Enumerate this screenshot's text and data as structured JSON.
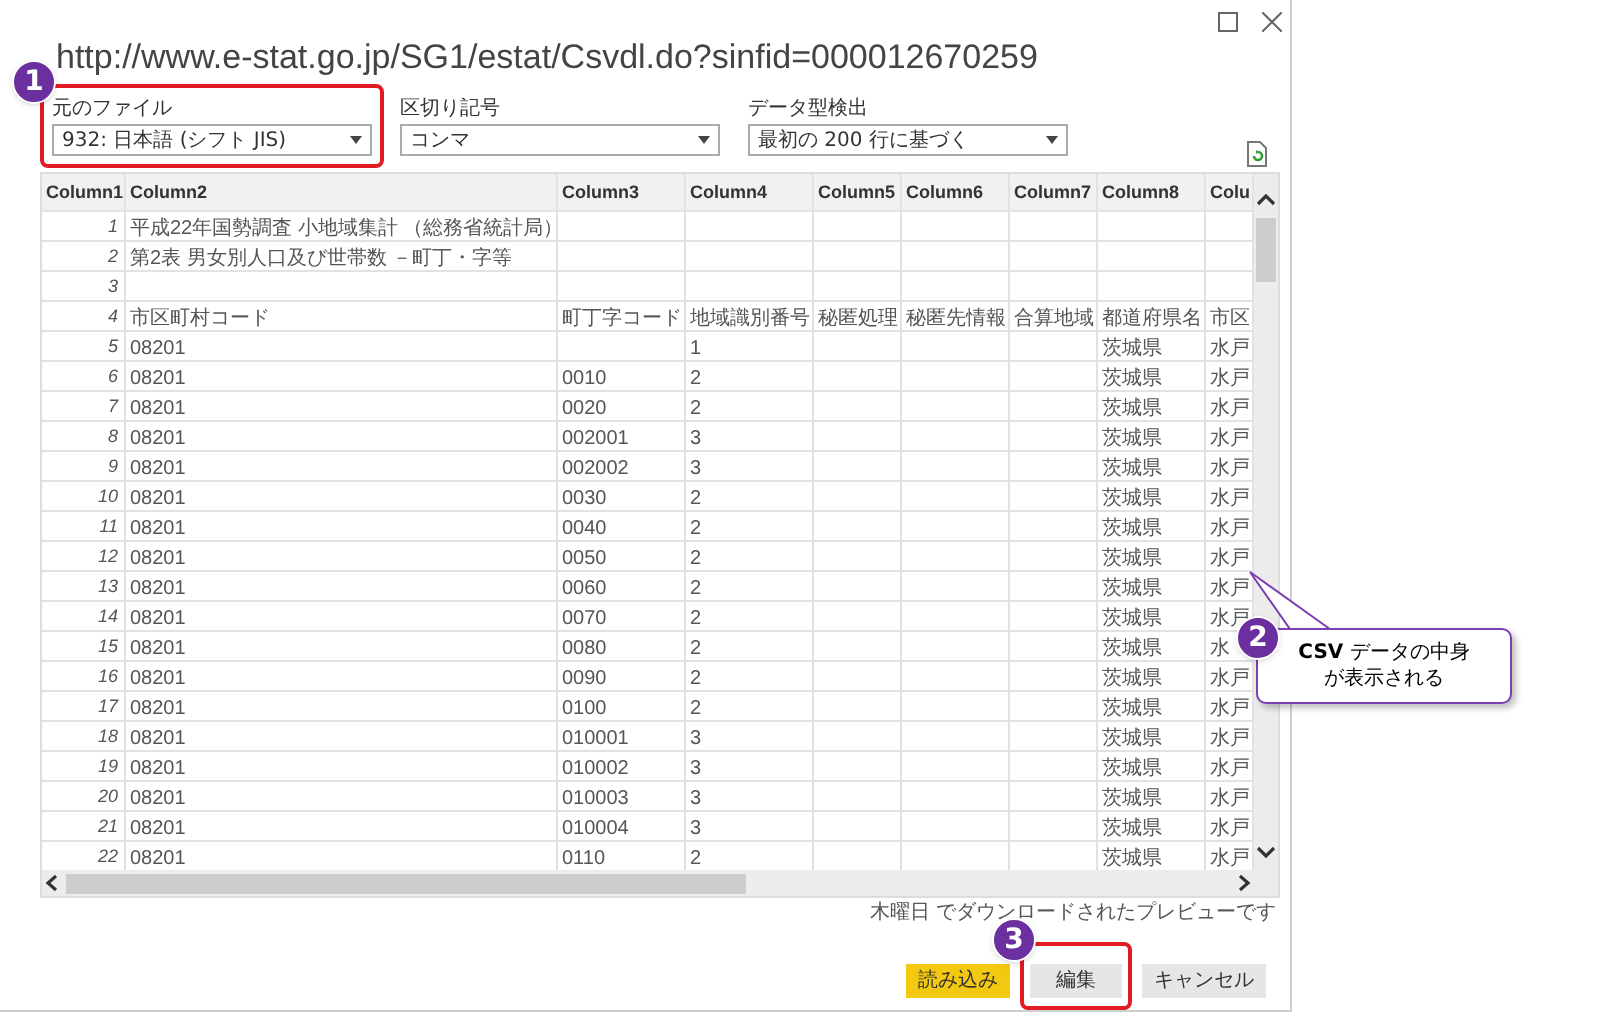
{
  "window": {
    "title": "http://www.e-stat.go.jp/SG1/estat/Csvdl.do?sinfid=000012670259"
  },
  "options": [
    {
      "label": "元のファイル",
      "value": "932: 日本語 (シフト JIS)",
      "highlighted": true
    },
    {
      "label": "区切り記号",
      "value": "コンマ",
      "highlighted": false
    },
    {
      "label": "データ型検出",
      "value": "最初の 200 行に基づく",
      "highlighted": false
    }
  ],
  "table": {
    "columns": [
      "Column1",
      "Column2",
      "Column3",
      "Column4",
      "Column5",
      "Column6",
      "Column7",
      "Column8",
      "Colu"
    ],
    "rows": [
      {
        "number": "1",
        "cells": {
          "column2": "平成22年国勢調査 小地域集計 （総務省統計局）"
        }
      },
      {
        "number": "2",
        "cells": {
          "column2": "第2表 男女別人口及び世帯数 －町丁・字等"
        }
      },
      {
        "number": "3",
        "cells": {}
      },
      {
        "number": "4",
        "cells": {
          "column2": "市区町村コード",
          "column3": "町丁字コード",
          "column4": "地域識別番号",
          "column5": "秘匿処理",
          "column6": "秘匿先情報",
          "column7": "合算地域",
          "column8": "都道府県名",
          "column9": "市区"
        }
      },
      {
        "number": "5",
        "cells": {
          "column2": "08201",
          "column4": "1",
          "column8": "茨城県",
          "column9": "水戸"
        }
      },
      {
        "number": "6",
        "cells": {
          "column2": "08201",
          "column3": "0010",
          "column4": "2",
          "column8": "茨城県",
          "column9": "水戸"
        }
      },
      {
        "number": "7",
        "cells": {
          "column2": "08201",
          "column3": "0020",
          "column4": "2",
          "column8": "茨城県",
          "column9": "水戸"
        }
      },
      {
        "number": "8",
        "cells": {
          "column2": "08201",
          "column3": "002001",
          "column4": "3",
          "column8": "茨城県",
          "column9": "水戸"
        }
      },
      {
        "number": "9",
        "cells": {
          "column2": "08201",
          "column3": "002002",
          "column4": "3",
          "column8": "茨城県",
          "column9": "水戸"
        }
      },
      {
        "number": "10",
        "cells": {
          "column2": "08201",
          "column3": "0030",
          "column4": "2",
          "column8": "茨城県",
          "column9": "水戸"
        }
      },
      {
        "number": "11",
        "cells": {
          "column2": "08201",
          "column3": "0040",
          "column4": "2",
          "column8": "茨城県",
          "column9": "水戸"
        }
      },
      {
        "number": "12",
        "cells": {
          "column2": "08201",
          "column3": "0050",
          "column4": "2",
          "column8": "茨城県",
          "column9": "水戸"
        }
      },
      {
        "number": "13",
        "cells": {
          "column2": "08201",
          "column3": "0060",
          "column4": "2",
          "column8": "茨城県",
          "column9": "水戸"
        }
      },
      {
        "number": "14",
        "cells": {
          "column2": "08201",
          "column3": "0070",
          "column4": "2",
          "column8": "茨城県",
          "column9": "水戸"
        }
      },
      {
        "number": "15",
        "cells": {
          "column2": "08201",
          "column3": "0080",
          "column4": "2",
          "column8": "茨城県",
          "column9": "水"
        }
      },
      {
        "number": "16",
        "cells": {
          "column2": "08201",
          "column3": "0090",
          "column4": "2",
          "column8": "茨城県",
          "column9": "水戸"
        }
      },
      {
        "number": "17",
        "cells": {
          "column2": "08201",
          "column3": "0100",
          "column4": "2",
          "column8": "茨城県",
          "column9": "水戸"
        }
      },
      {
        "number": "18",
        "cells": {
          "column2": "08201",
          "column3": "010001",
          "column4": "3",
          "column8": "茨城県",
          "column9": "水戸"
        }
      },
      {
        "number": "19",
        "cells": {
          "column2": "08201",
          "column3": "010002",
          "column4": "3",
          "column8": "茨城県",
          "column9": "水戸"
        }
      },
      {
        "number": "20",
        "cells": {
          "column2": "08201",
          "column3": "010003",
          "column4": "3",
          "column8": "茨城県",
          "column9": "水戸"
        }
      },
      {
        "number": "21",
        "cells": {
          "column2": "08201",
          "column3": "010004",
          "column4": "3",
          "column8": "茨城県",
          "column9": "水戸"
        }
      },
      {
        "number": "22",
        "cells": {
          "column2": "08201",
          "column3": "0110",
          "column4": "2",
          "column8": "茨城県",
          "column9": "水戸"
        }
      }
    ]
  },
  "status": "木曜日 でダウンロードされたプレビューです",
  "buttons": [
    {
      "label": "読み込み",
      "kind": "primary",
      "highlighted": false
    },
    {
      "label": "編集",
      "kind": "secondary",
      "highlighted": true
    },
    {
      "label": "キャンセル",
      "kind": "secondary",
      "highlighted": false
    }
  ],
  "annotations": [
    {
      "number": "1"
    },
    {
      "number": "2",
      "callout": [
        "**CSV** データの中身",
        "が表示される"
      ]
    },
    {
      "number": "3"
    }
  ]
}
